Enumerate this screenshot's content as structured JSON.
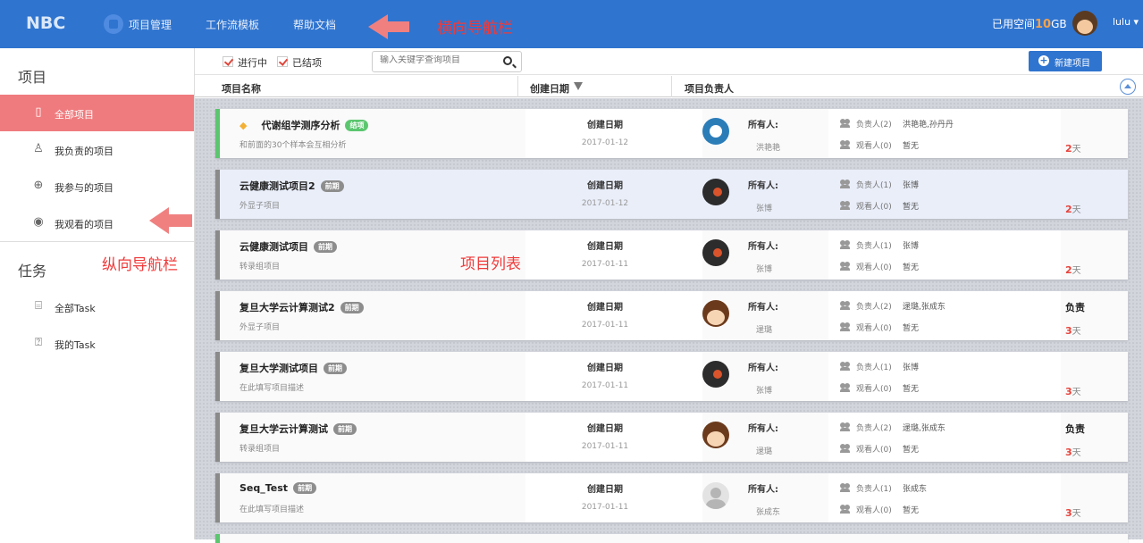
{
  "topnav": {
    "logo": "NBC",
    "items": [
      "项目管理",
      "工作流模板",
      "帮助文档"
    ],
    "annotation": "横向导航栏",
    "quota_label": "已用空间",
    "quota_value": "10",
    "quota_unit": "GB",
    "user": "lulu ▾"
  },
  "sidebar": {
    "project_heading": "项目",
    "project_items": [
      "全部项目",
      "我负责的项目",
      "我参与的项目",
      "我观看的项目"
    ],
    "task_heading": "任务",
    "task_items": [
      "全部Task",
      "我的Task"
    ],
    "annotation": "纵向导航栏"
  },
  "filters": {
    "in_progress": "进行中",
    "closed": "已结项",
    "search_placeholder": "输入关键字查询项目",
    "new_button": "新建项目"
  },
  "columns": [
    "项目名称",
    "创建日期",
    "项目负责人"
  ],
  "list_annotation": "项目列表",
  "card_labels": {
    "date_label": "创建日期",
    "owner_label": "所有人:",
    "lead_prefix": "负责人",
    "watch_prefix": "观看人",
    "days_suffix": "天"
  },
  "projects": [
    {
      "name": "代谢组学测序分析",
      "badge": "结项",
      "desc": "和前面的30个样本会互相分析",
      "date": "2017-01-12",
      "owner": "洪艳艳",
      "leads": "(2)",
      "leads_names": "洪艳艳,孙丹丹",
      "watch": "(0)",
      "watch_names": "暂无",
      "role": "",
      "days": "2"
    },
    {
      "name": "云健康测试项目2",
      "badge": "前期",
      "desc": "外显子项目",
      "date": "2017-01-12",
      "owner": "张博",
      "leads": "(1)",
      "leads_names": "张博",
      "watch": "(0)",
      "watch_names": "暂无",
      "role": "",
      "days": "2"
    },
    {
      "name": "云健康测试项目",
      "badge": "前期",
      "desc": "转录组项目",
      "date": "2017-01-11",
      "owner": "张博",
      "leads": "(1)",
      "leads_names": "张博",
      "watch": "(0)",
      "watch_names": "暂无",
      "role": "",
      "days": "2"
    },
    {
      "name": "复旦大学云计算测试2",
      "badge": "前期",
      "desc": "外显子项目",
      "date": "2017-01-11",
      "owner": "逯璐",
      "leads": "(2)",
      "leads_names": "逯璐,张成东",
      "watch": "(0)",
      "watch_names": "暂无",
      "role": "负责",
      "days": "3"
    },
    {
      "name": "复旦大学测试项目",
      "badge": "前期",
      "desc": "在此填写项目描述",
      "date": "2017-01-11",
      "owner": "张博",
      "leads": "(1)",
      "leads_names": "张博",
      "watch": "(0)",
      "watch_names": "暂无",
      "role": "",
      "days": "3"
    },
    {
      "name": "复旦大学云计算测试",
      "badge": "前期",
      "desc": "转录组项目",
      "date": "2017-01-11",
      "owner": "逯璐",
      "leads": "(2)",
      "leads_names": "逯璐,张成东",
      "watch": "(0)",
      "watch_names": "暂无",
      "role": "负责",
      "days": "3"
    },
    {
      "name": "Seq_Test",
      "badge": "前期",
      "desc": "在此填写项目描述",
      "date": "2017-01-11",
      "owner": "张成东",
      "leads": "(1)",
      "leads_names": "张成东",
      "watch": "(0)",
      "watch_names": "暂无",
      "role": "",
      "days": "3"
    }
  ],
  "colors": {
    "primary": "#2f74cf",
    "active_side": "#ef7b7e",
    "annotation": "#f03a3a",
    "finished": "#5bc66f"
  }
}
